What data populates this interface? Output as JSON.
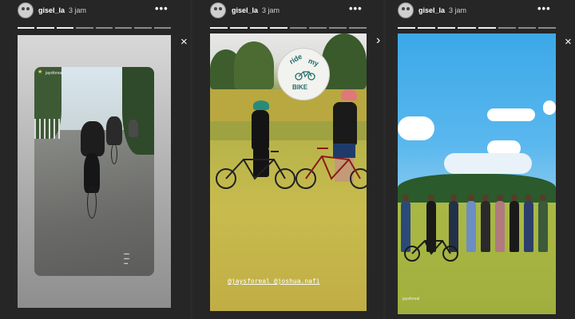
{
  "panels": [
    {
      "username": "gisel_la",
      "time": "3 jam",
      "more": "•••",
      "action_icon": "×"
    },
    {
      "username": "gisel_la",
      "time": "3 jam",
      "more": "•••",
      "action_icon": "›"
    },
    {
      "username": "gisel_la",
      "time": "3 jam",
      "more": "•••",
      "action_icon": "×"
    }
  ],
  "story1": {
    "reposter": "jaysforeal"
  },
  "story2": {
    "sticker_line1": "ride",
    "sticker_line2": "my",
    "sticker_line3": "BIKE",
    "mentions": "@jaysforeal @joshua.nafi"
  },
  "story3": {
    "caption": "jaysforeal"
  },
  "colors": {
    "background": "#2a2a2a",
    "sticker_text": "#1e6e6a",
    "sky": "#3ca8e8",
    "rice": "#c4b348"
  }
}
